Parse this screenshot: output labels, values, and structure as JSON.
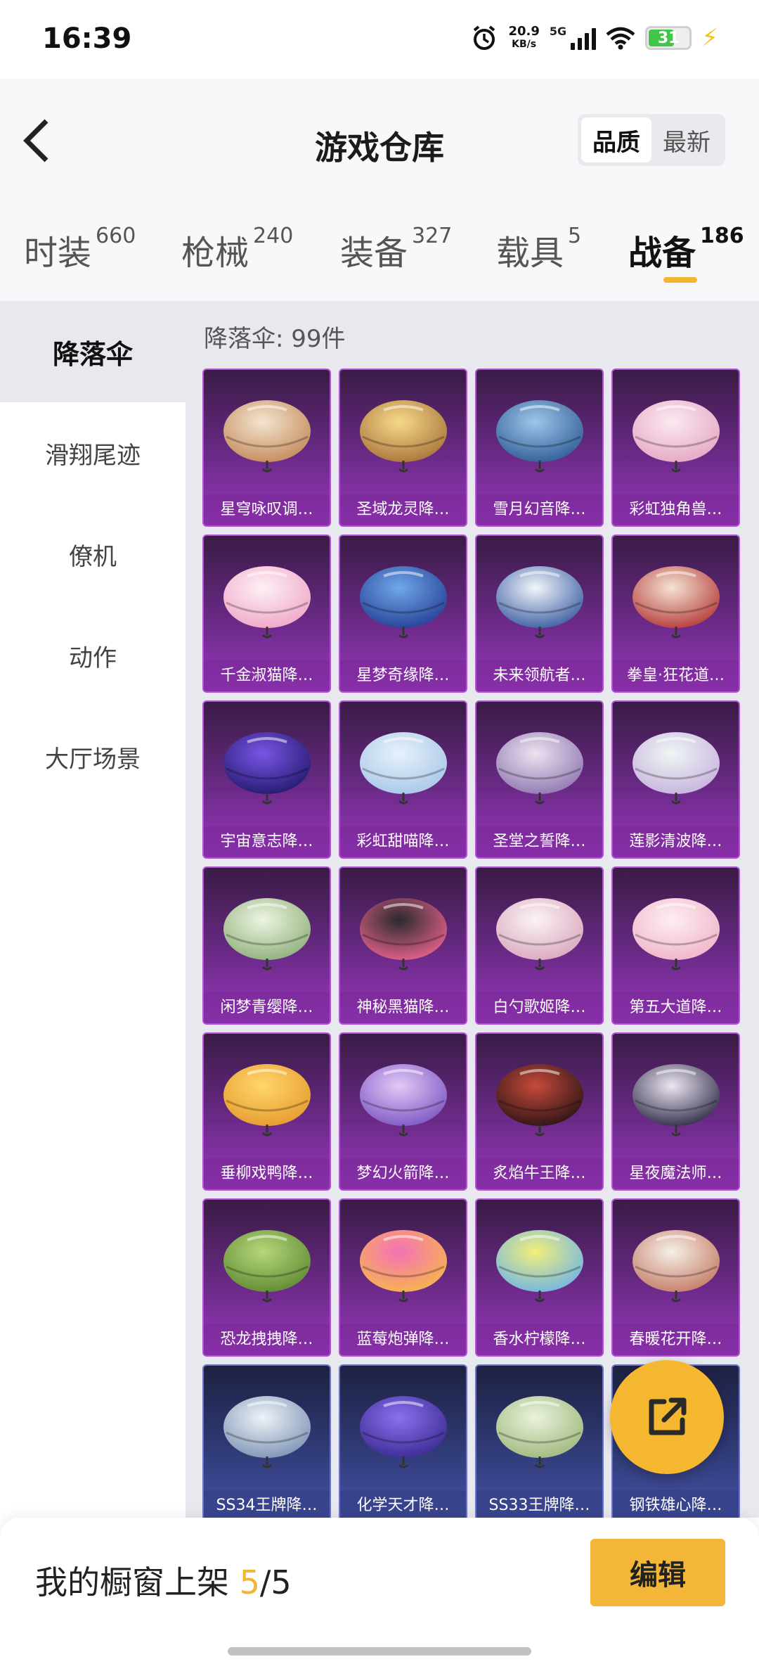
{
  "status_bar": {
    "time": "16:39",
    "net_speed_value": "20.9",
    "net_speed_unit": "KB/s",
    "network": "5G",
    "battery": "31",
    "icons": [
      "alarm-icon",
      "signal-icon",
      "wifi-icon",
      "battery-icon",
      "charging-icon"
    ]
  },
  "header": {
    "title": "游戏仓库",
    "sort_options": [
      "品质",
      "最新"
    ],
    "sort_selected": "品质"
  },
  "tabs": [
    {
      "label": "时装",
      "count": "660"
    },
    {
      "label": "枪械",
      "count": "240"
    },
    {
      "label": "装备",
      "count": "327"
    },
    {
      "label": "载具",
      "count": "5"
    },
    {
      "label": "战备",
      "count": "186",
      "active": true
    }
  ],
  "sidebar": {
    "items": [
      "降落伞",
      "滑翔尾迹",
      "僚机",
      "动作",
      "大厅场景"
    ],
    "active": "降落伞"
  },
  "content": {
    "count_label": "降落伞: 99件",
    "items": [
      {
        "name": "星穹咏叹调…",
        "theme": "purple",
        "colors": [
          "#f3e4cf",
          "#c48a5a"
        ]
      },
      {
        "name": "圣域龙灵降…",
        "theme": "purple",
        "colors": [
          "#f6d98a",
          "#a9743a"
        ]
      },
      {
        "name": "雪月幻音降…",
        "theme": "purple",
        "colors": [
          "#9fc6ea",
          "#2f5d96"
        ]
      },
      {
        "name": "彩虹独角兽…",
        "theme": "purple",
        "colors": [
          "#fbe9f1",
          "#e6a7c4"
        ]
      },
      {
        "name": "千金淑猫降…",
        "theme": "purple",
        "colors": [
          "#fdf0f5",
          "#f0a6c8"
        ]
      },
      {
        "name": "星梦奇缘降…",
        "theme": "purple",
        "colors": [
          "#6fa8e8",
          "#263f96"
        ]
      },
      {
        "name": "未来领航者…",
        "theme": "purple",
        "colors": [
          "#f3f6fb",
          "#3b5da3"
        ]
      },
      {
        "name": "拳皇·狂花道…",
        "theme": "purple",
        "colors": [
          "#f4e3d2",
          "#b53a3a"
        ]
      },
      {
        "name": "宇宙意志降…",
        "theme": "purple",
        "colors": [
          "#7a55e6",
          "#231a6e"
        ]
      },
      {
        "name": "彩虹甜喵降…",
        "theme": "purple",
        "colors": [
          "#e7f1fb",
          "#a8c7e8"
        ]
      },
      {
        "name": "圣堂之誓降…",
        "theme": "purple",
        "colors": [
          "#ece3f0",
          "#8f77b1"
        ]
      },
      {
        "name": "莲影清波降…",
        "theme": "purple",
        "colors": [
          "#eef6f3",
          "#c7b2de"
        ]
      },
      {
        "name": "闲梦青缨降…",
        "theme": "purple",
        "colors": [
          "#eef4e2",
          "#8eb07a"
        ]
      },
      {
        "name": "神秘黑猫降…",
        "theme": "purple",
        "colors": [
          "#2a2a2e",
          "#e8638c"
        ]
      },
      {
        "name": "白勺歌姬降…",
        "theme": "purple",
        "colors": [
          "#fbf3f6",
          "#d9a7bd"
        ]
      },
      {
        "name": "第五大道降…",
        "theme": "purple",
        "colors": [
          "#fdeef2",
          "#f0b4c9"
        ]
      },
      {
        "name": "垂柳戏鸭降…",
        "theme": "purple",
        "colors": [
          "#ffd66b",
          "#e69b2f"
        ]
      },
      {
        "name": "梦幻火箭降…",
        "theme": "purple",
        "colors": [
          "#e2c9f6",
          "#7d56c4"
        ]
      },
      {
        "name": "炙焰牛王降…",
        "theme": "purple",
        "colors": [
          "#c74a3a",
          "#2a1416"
        ]
      },
      {
        "name": "星夜魔法师…",
        "theme": "purple",
        "colors": [
          "#ece6f2",
          "#2f2b46"
        ]
      },
      {
        "name": "恐龙拽拽降…",
        "theme": "purple",
        "colors": [
          "#b6d77a",
          "#5f8a33"
        ]
      },
      {
        "name": "蓝莓炮弹降…",
        "theme": "purple",
        "colors": [
          "#f471b8",
          "#f7b64b"
        ]
      },
      {
        "name": "香水柠檬降…",
        "theme": "purple",
        "colors": [
          "#f2ef7a",
          "#6fb5e6"
        ]
      },
      {
        "name": "春暖花开降…",
        "theme": "purple",
        "colors": [
          "#f5efe6",
          "#c57b67"
        ]
      },
      {
        "name": "SS34王牌降…",
        "theme": "blue",
        "colors": [
          "#eef3f8",
          "#7d93b5"
        ]
      },
      {
        "name": "化学天才降…",
        "theme": "blue",
        "colors": [
          "#8c6ff0",
          "#3a2b8f"
        ]
      },
      {
        "name": "SS33王牌降…",
        "theme": "blue",
        "colors": [
          "#eaf2dd",
          "#9fb87c"
        ]
      },
      {
        "name": "钢铁雄心降…",
        "theme": "blue",
        "colors": [
          "#c9ced8",
          "#5f6478"
        ]
      }
    ]
  },
  "bottom_bar": {
    "label_prefix": "我的橱窗上架",
    "current": "5",
    "separator": "/",
    "total": "5",
    "edit_label": "编辑"
  },
  "colors": {
    "accent": "#f2b431",
    "card_purple": "#6a2a86",
    "card_blue": "#303b78",
    "fab": "#f5b72f"
  }
}
